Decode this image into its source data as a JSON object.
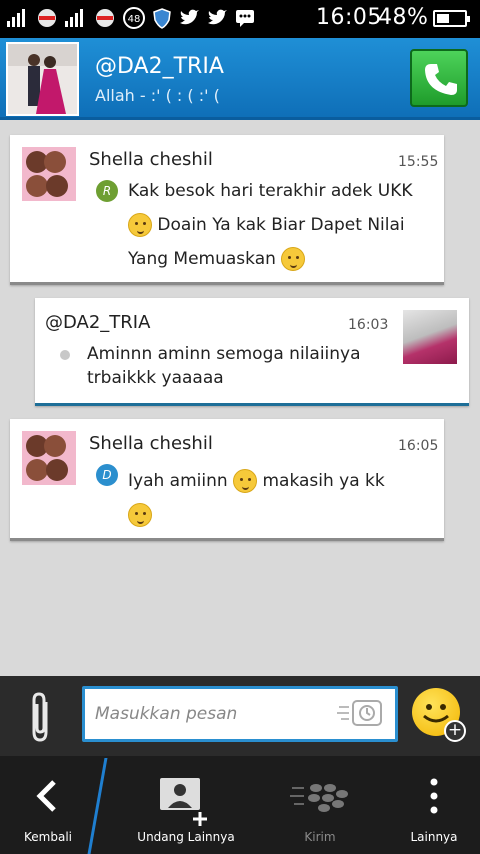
{
  "status_bar": {
    "time": "16:05",
    "battery": "48%",
    "battery_level": 0.48,
    "icons": [
      "signal-icon",
      "signal-icon",
      "bbm-notification-icon",
      "twitter-icon",
      "twitter-icon",
      "chat-icon"
    ],
    "badge_count": "48"
  },
  "header": {
    "contact_name": "@DA2_TRIA",
    "contact_status": "Allah - :' ( : ( :' ("
  },
  "messages": [
    {
      "sender": "Shella cheshil",
      "time": "15:55",
      "status": "R",
      "lines": [
        "Kak besok hari terakhir adek UKK",
        "Doain Ya kak Biar Dapet Nilai",
        "Yang Memuaskan"
      ]
    },
    {
      "sender": "@DA2_TRIA",
      "time": "16:03",
      "lines": [
        "Aminnn aminn semoga nilaiinya",
        "trbaikkk yaaaaa"
      ]
    },
    {
      "sender": "Shella cheshil",
      "time": "16:05",
      "status": "D",
      "lines": [
        "Iyah amiinn",
        "makasih ya kk"
      ]
    }
  ],
  "composer": {
    "placeholder": "Masukkan pesan"
  },
  "actions": {
    "back": "Kembali",
    "invite": "Undang Lainnya",
    "send": "Kirim",
    "more": "Lainnya"
  },
  "colors": {
    "header_blue": "#1f8fd6",
    "accent_blue": "#2a8fd0",
    "read_green": "#6e9f32",
    "delivered_blue": "#2b8fce"
  }
}
